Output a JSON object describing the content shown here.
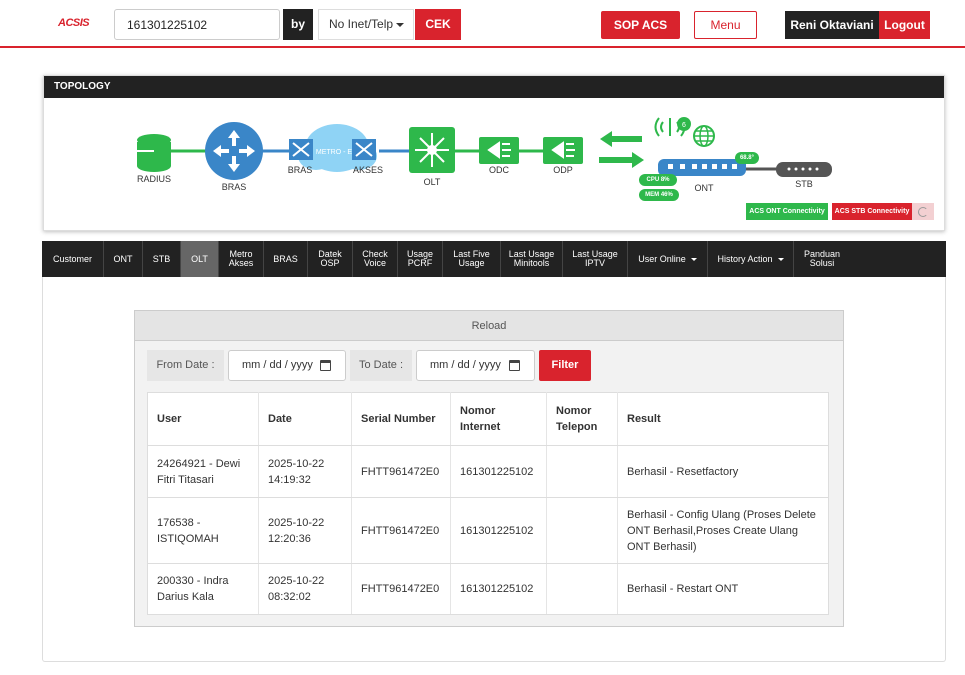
{
  "header": {
    "logo": "ACSIS",
    "search_value": "161301225102",
    "by_label": "by",
    "select_value": "No Inet/Telp",
    "cek_label": "CEK",
    "sop_label": "SOP ACS",
    "menu_label": "Menu",
    "user_name": "Reni Oktaviani",
    "logout_label": "Logout"
  },
  "topology": {
    "title": "TOPOLOGY",
    "nodes": {
      "radius": "RADIUS",
      "bras": "BRAS",
      "bras2": "BRAS",
      "metro": "METRO - E",
      "akses": "AKSES",
      "olt": "OLT",
      "odc": "ODC",
      "odp": "ODP",
      "ont": "ONT",
      "stb": "STB"
    },
    "ont_badge": "6",
    "temp": "68.8°",
    "cpu": "CPU 8%",
    "mem": "MEM 46%",
    "acs_ont": "ACS ONT Connectivity",
    "acs_stb": "ACS STB Connectivity",
    "colors": {
      "green": "#2eb84b",
      "blue": "#3a86c8",
      "red": "#d9232d"
    }
  },
  "tabs": [
    {
      "label": "Customer"
    },
    {
      "label": "ONT"
    },
    {
      "label": "STB"
    },
    {
      "label": "OLT",
      "active": true
    },
    {
      "label": "Metro Akses"
    },
    {
      "label": "BRAS"
    },
    {
      "label": "Datek OSP"
    },
    {
      "label": "Check Voice"
    },
    {
      "label": "Usage PCRF"
    },
    {
      "label": "Last Five Usage"
    },
    {
      "label": "Last Usage Minitools"
    },
    {
      "label": "Last Usage IPTV"
    },
    {
      "label": "User Online",
      "dropdown": true
    },
    {
      "label": "History Action",
      "dropdown": true
    },
    {
      "label": "Panduan Solusi"
    }
  ],
  "panel": {
    "reload_label": "Reload",
    "from_label": "From Date :",
    "from_placeholder": "mm / dd / yyyy",
    "to_label": "To Date :",
    "to_placeholder": "mm / dd / yyyy",
    "filter_label": "Filter",
    "columns": [
      "User",
      "Date",
      "Serial Number",
      "Nomor Internet",
      "Nomor Telepon",
      "Result"
    ],
    "rows": [
      {
        "user": "24264921 - Dewi Fitri Titasari",
        "date": "2025-10-22 14:19:32",
        "serial": "FHTT961472E0",
        "internet": "161301225102",
        "telepon": "",
        "result": "Berhasil - Resetfactory"
      },
      {
        "user": "176538 - ISTIQOMAH",
        "date": "2025-10-22 12:20:36",
        "serial": "FHTT961472E0",
        "internet": "161301225102",
        "telepon": "",
        "result": "Berhasil - Config Ulang (Proses Delete ONT Berhasil,Proses Create Ulang ONT Berhasil)"
      },
      {
        "user": "200330 - Indra Darius Kala",
        "date": "2025-10-22 08:32:02",
        "serial": "FHTT961472E0",
        "internet": "161301225102",
        "telepon": "",
        "result": "Berhasil - Restart ONT"
      }
    ]
  }
}
